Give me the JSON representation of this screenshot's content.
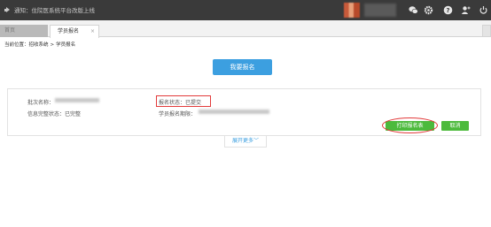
{
  "topbar": {
    "notice_text": "通知：住院医系统平台改版上线",
    "icons": [
      "wechat-icon",
      "gear-icon",
      "help-icon",
      "user-add-icon",
      "power-icon"
    ]
  },
  "tabs": {
    "home_label": "首页",
    "active_label": "学员报名",
    "close_glyph": "×"
  },
  "breadcrumb": {
    "prefix": "当前位置：",
    "items": [
      "招收系统",
      "学员报名"
    ],
    "separator": ">"
  },
  "main": {
    "apply_button": "我要报名"
  },
  "registration_card": {
    "batch_name_label": "批次名称：",
    "info_status_label": "信息完整状态：",
    "info_status_value": "已完整",
    "apply_status_label": "报名状态：",
    "apply_status_value": "已提交",
    "deadline_label": "学员报名期限：",
    "print_button": "打印报名表",
    "cancel_button": "取消"
  },
  "expand_more": {
    "label": "展开更多",
    "chevron": "﹀"
  },
  "colors": {
    "topbar": "#3a3a3a",
    "primary_blue": "#3c9fe0",
    "green": "#4cba3c",
    "highlight_red": "#e23a3a"
  }
}
